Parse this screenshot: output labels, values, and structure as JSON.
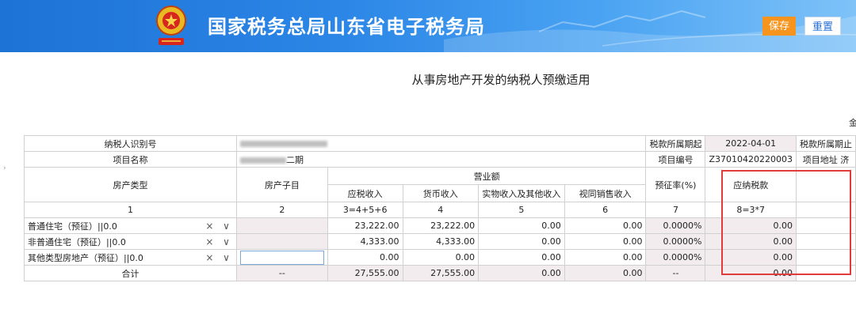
{
  "header": {
    "title": "国家税务总局山东省电子税务局",
    "save_label": "保存",
    "reset_label": "重置",
    "colors": {
      "banner": "#1e73d6",
      "save": "#f7941d",
      "highlight": "#e23b3b"
    }
  },
  "page": {
    "title": "从事房地产开发的纳税人预缴适用",
    "unit_hint": "金"
  },
  "info": {
    "taxpayer_id_label": "纳税人识别号",
    "period_start_label": "税款所属期起",
    "period_start_value": "2022-04-01",
    "period_end_label": "税款所属期止",
    "project_name_label": "项目名称",
    "project_name_suffix": "二期",
    "project_no_label": "项目编号",
    "project_no_value": "Z37010420220003",
    "project_addr_label": "项目地址",
    "project_addr_value": "济"
  },
  "columns": {
    "property_type": "房产类型",
    "property_sub": "房产子目",
    "revenue_group": "营业额",
    "taxable_income": "应税收入",
    "monetary_income": "货币收入",
    "inkind_income": "实物收入及其他收入",
    "deemed_sales": "视同销售收入",
    "levy_rate": "预征率(%)",
    "tax_payable": "应纳税款",
    "idx": [
      "1",
      "2",
      "3=4+5+6",
      "4",
      "5",
      "6",
      "7",
      "8=3*7"
    ]
  },
  "rows": [
    {
      "type": "普通住宅（预征）||0.0",
      "sub": "",
      "taxable": "23,222.00",
      "monetary": "23,222.00",
      "inkind": "0.00",
      "deemed": "0.00",
      "rate": "0.0000%",
      "tax": "0.00"
    },
    {
      "type": "非普通住宅（预征）||0.0",
      "sub": "",
      "taxable": "4,333.00",
      "monetary": "4,333.00",
      "inkind": "0.00",
      "deemed": "0.00",
      "rate": "0.0000%",
      "tax": "0.00"
    },
    {
      "type": "其他类型房地产（预征）||0.0",
      "sub": "",
      "taxable": "0.00",
      "monetary": "0.00",
      "inkind": "0.00",
      "deemed": "0.00",
      "rate": "0.0000%",
      "tax": "0.00"
    }
  ],
  "total": {
    "label": "合计",
    "sub": "--",
    "taxable": "27,555.00",
    "monetary": "27,555.00",
    "inkind": "0.00",
    "deemed": "0.00",
    "rate": "--",
    "tax": "0.00"
  },
  "select_controls": "× ∨"
}
